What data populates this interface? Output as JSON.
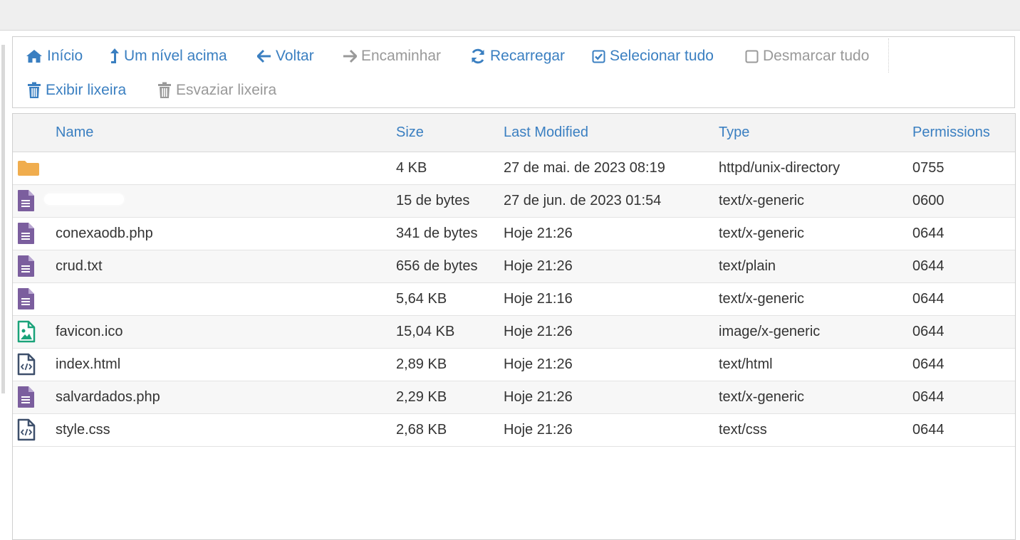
{
  "toolbar": {
    "home": {
      "label": "Início",
      "icon": "home-icon"
    },
    "up_level": {
      "label": "Um nível acima",
      "icon": "level-up-icon"
    },
    "back": {
      "label": "Voltar",
      "icon": "arrow-left-icon"
    },
    "forward": {
      "label": "Encaminhar",
      "icon": "arrow-right-icon"
    },
    "reload": {
      "label": "Recarregar",
      "icon": "refresh-icon"
    },
    "select_all": {
      "label": "Selecionar tudo",
      "icon": "checked-box-icon"
    },
    "unselect_all": {
      "label": "Desmarcar tudo",
      "icon": "empty-box-icon"
    },
    "view_trash": {
      "label": "Exibir lixeira",
      "icon": "trash-icon"
    },
    "empty_trash": {
      "label": "Esvaziar lixeira",
      "icon": "trash-icon"
    }
  },
  "table": {
    "headers": {
      "name": "Name",
      "size": "Size",
      "modified": "Last Modified",
      "type": "Type",
      "permissions": "Permissions"
    },
    "rows": [
      {
        "icon": "folder-icon",
        "name": "",
        "size": "4 KB",
        "modified": "27 de mai. de 2023 08:19",
        "type": "httpd/unix-directory",
        "perm": "0755"
      },
      {
        "icon": "text-file-icon",
        "name": "",
        "size": "15 de bytes",
        "modified": "27 de jun. de 2023 01:54",
        "type": "text/x-generic",
        "perm": "0600"
      },
      {
        "icon": "text-file-icon",
        "name": "conexaodb.php",
        "size": "341 de bytes",
        "modified": "Hoje 21:26",
        "type": "text/x-generic",
        "perm": "0644"
      },
      {
        "icon": "text-file-icon",
        "name": "crud.txt",
        "size": "656 de bytes",
        "modified": "Hoje 21:26",
        "type": "text/plain",
        "perm": "0644"
      },
      {
        "icon": "text-file-icon",
        "name": "",
        "size": "5,64 KB",
        "modified": "Hoje 21:16",
        "type": "text/x-generic",
        "perm": "0644"
      },
      {
        "icon": "image-file-icon",
        "name": "favicon.ico",
        "size": "15,04 KB",
        "modified": "Hoje 21:26",
        "type": "image/x-generic",
        "perm": "0644"
      },
      {
        "icon": "code-file-icon",
        "name": "index.html",
        "size": "2,89 KB",
        "modified": "Hoje 21:26",
        "type": "text/html",
        "perm": "0644"
      },
      {
        "icon": "text-file-icon",
        "name": "salvardados.php",
        "size": "2,29 KB",
        "modified": "Hoje 21:26",
        "type": "text/x-generic",
        "perm": "0644"
      },
      {
        "icon": "code-file-icon",
        "name": "style.css",
        "size": "2,68 KB",
        "modified": "Hoje 21:26",
        "type": "text/css",
        "perm": "0644"
      }
    ]
  },
  "colors": {
    "link": "#3a7fc1",
    "disabled": "#999999",
    "folder": "#f0ad4e",
    "text_file": "#7b5e9e",
    "image_file": "#1aa37a",
    "code_file": "#3d4f6b"
  }
}
